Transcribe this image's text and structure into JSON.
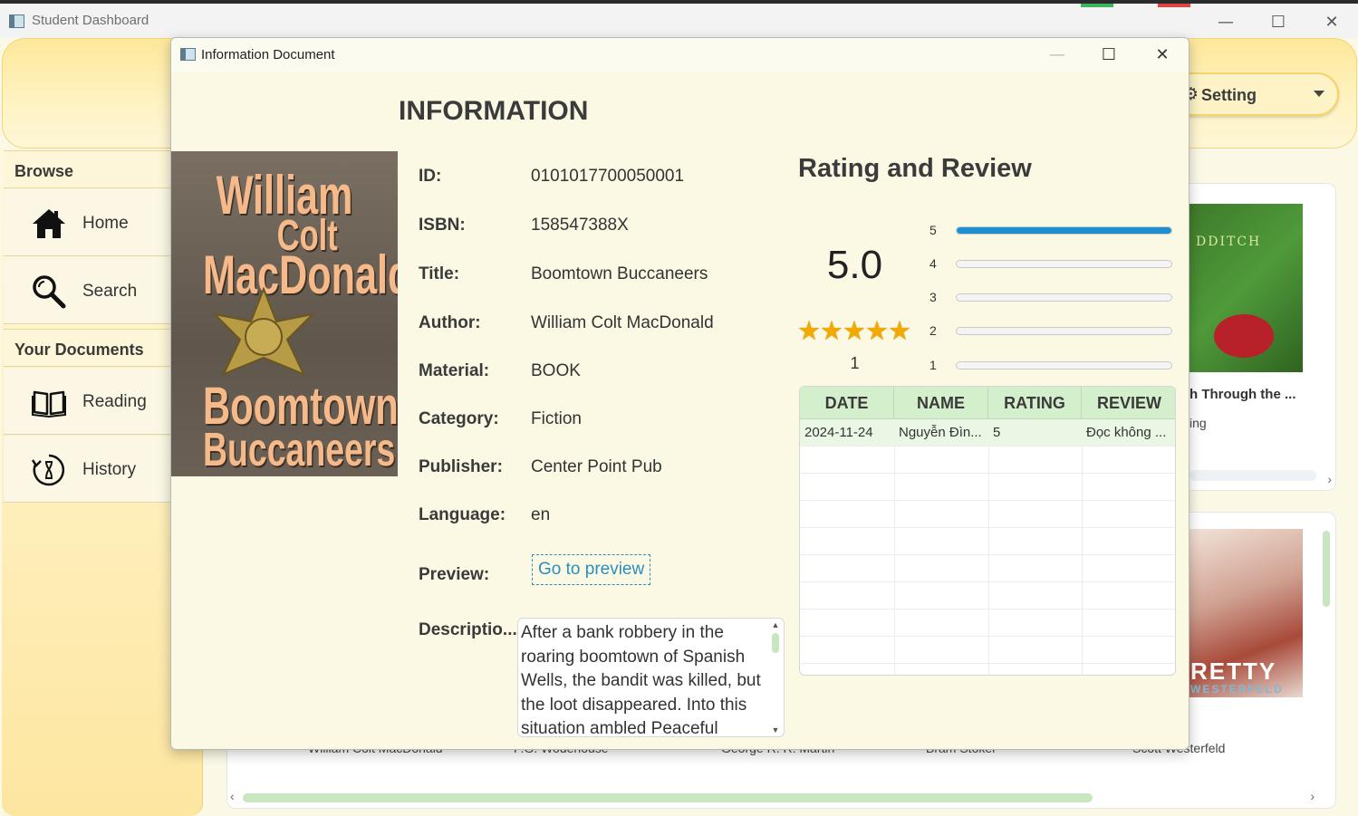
{
  "main_window": {
    "title": "Student Dashboard",
    "controls": {
      "minimize": "—",
      "maximize": "☐",
      "close": "✕"
    }
  },
  "dashboard": {
    "setting_label": "Setting",
    "sidebar": {
      "browse_header": "Browse",
      "browse_items": [
        {
          "label": "Home",
          "icon": "home-icon"
        },
        {
          "label": "Search",
          "icon": "search-icon"
        }
      ],
      "documents_header": "Your Documents",
      "document_items": [
        {
          "label": "Reading",
          "icon": "book-open-icon"
        },
        {
          "label": "History",
          "icon": "history-icon"
        }
      ]
    },
    "background_cards": {
      "card1_title": "h Through the ...",
      "card1_subtitle": "ing",
      "card1_cover_text": "DDITCH",
      "card2_cover_text": "RETTY",
      "card2_cover_author": "WESTERFELD",
      "authors": [
        "William Colt MacDonald",
        "P.G. Wodehouse",
        "George R. R. Martin",
        "Bram Stoker",
        "Scott Westerfeld"
      ]
    }
  },
  "dialog": {
    "title": "Information Document",
    "heading": "INFORMATION",
    "cover_lines": [
      "William",
      "Colt",
      "MacDonald",
      "Boomtown",
      "Buccaneers"
    ],
    "fields": [
      {
        "label": "ID:",
        "value": "0101017700050001"
      },
      {
        "label": "ISBN:",
        "value": "158547388X"
      },
      {
        "label": "Title:",
        "value": "Boomtown Buccaneers"
      },
      {
        "label": "Author:",
        "value": "William Colt MacDonald"
      },
      {
        "label": "Material:",
        "value": "BOOK"
      },
      {
        "label": "Category:",
        "value": "Fiction"
      },
      {
        "label": "Publisher:",
        "value": "Center Point Pub"
      },
      {
        "label": "Language:",
        "value": "en"
      }
    ],
    "preview_label": "Preview:",
    "preview_link": "Go to preview",
    "description_label": "Descriptio...",
    "description_text": "After a bank robbery in the roaring boomtown of Spanish Wells, the bandit was killed, but the loot disappeared. Into this situation ambled Peaceful",
    "rating": {
      "heading": "Rating and Review",
      "average": "5.0",
      "stars": "★★★★★",
      "review_count": "1",
      "distribution": [
        {
          "star": "5",
          "fraction": 1.0
        },
        {
          "star": "4",
          "fraction": 0.0
        },
        {
          "star": "3",
          "fraction": 0.0
        },
        {
          "star": "2",
          "fraction": 0.0
        },
        {
          "star": "1",
          "fraction": 0.0
        }
      ],
      "accent_color": "#1e8fd0",
      "star_color": "#f2a900"
    },
    "review_table": {
      "columns": [
        "DATE",
        "NAME",
        "RATING",
        "REVIEW"
      ],
      "rows": [
        {
          "date": "2024-11-24",
          "name": "Nguyễn Đìn...",
          "rating": "5",
          "review": "Đọc không ..."
        }
      ]
    }
  }
}
